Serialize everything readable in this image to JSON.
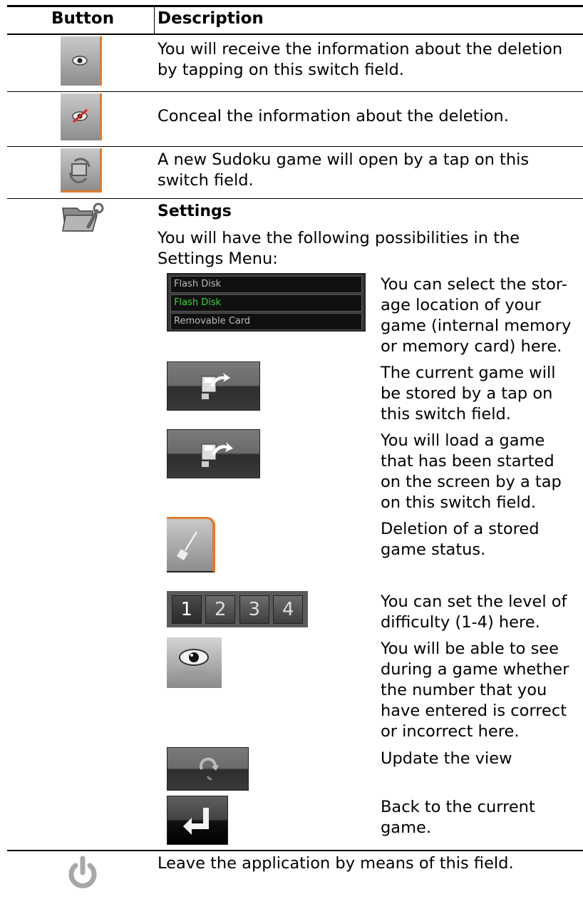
{
  "header": {
    "button": "Button",
    "description": "Description"
  },
  "rows": [
    {
      "icon": "eye-icon",
      "text": "You will receive the information about the deletion by tapping on this switch field."
    },
    {
      "icon": "eye-crossed-icon",
      "text": "Conceal the information about the deletion."
    },
    {
      "icon": "new-game-icon",
      "text": "A new Sudoku game will open by a tap on this switch field."
    },
    {
      "icon": "folder-wrench-icon",
      "title": "Settings",
      "text": "You will have the following possibilities in the Settings Menu:"
    },
    {
      "icon": "power-icon",
      "text": "Leave the application by means of this field."
    }
  ],
  "storage_dropdown": {
    "options": [
      "Flash Disk",
      "Flash Disk",
      "Removable Card"
    ],
    "selected_index": 1,
    "selected_color": "#3bd43b"
  },
  "levels": [
    "1",
    "2",
    "3",
    "4"
  ],
  "settings_items": [
    {
      "icon": "storage-dropdown",
      "text": "You can select the stor-age location of your game (internal memory or memory card) here."
    },
    {
      "icon": "save-game-icon",
      "text": "The current game will be stored by a tap on this switch field."
    },
    {
      "icon": "load-game-icon",
      "text": "You will load a game that has been started on the screen by a tap on this switch field."
    },
    {
      "icon": "broom-icon",
      "text": "Deletion of a stored game status."
    },
    {
      "icon": "level-selector",
      "text": "You can set the level of difficulty (1-4) here."
    },
    {
      "icon": "eye-icon",
      "text": "You will be able to see during a game whether the number that you have entered is correct or incorrect here."
    },
    {
      "icon": "refresh-icon",
      "text": "Update the view"
    },
    {
      "icon": "back-arrow-icon",
      "text": "Back to the current game."
    }
  ]
}
